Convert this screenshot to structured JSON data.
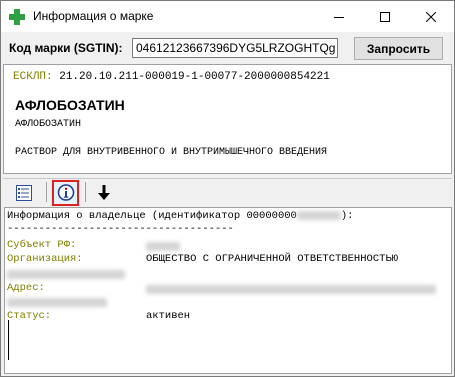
{
  "window": {
    "title": "Информация о марке",
    "controls": {
      "minimize": "minimize",
      "maximize": "maximize",
      "close": "close"
    }
  },
  "sgtin": {
    "label": "Код марки (SGTIN):",
    "value": "04612123667396DYG5LRZOGHTQg",
    "request_label": "Запросить"
  },
  "product": {
    "esklp_label": "ЕСКЛП:",
    "esklp_value": "21.20.10.211-000019-1-00077-2000000854221",
    "name": "АФЛОБОЗАТИН",
    "subname": "АФЛОБОЗАТИН",
    "form": "РАСТВОР ДЛЯ ВНУТРИВЕННОГО И ВНУТРИМЫШЕЧНОГО ВВЕДЕНИЯ"
  },
  "toolbar": {
    "list_icon": "list-icon",
    "info_icon": "info-icon",
    "download_icon": "arrow-down-icon"
  },
  "owner": {
    "header": "Информация о владельце (идентификатор 00000000",
    "header_end": "):",
    "separator": "------------------------------------",
    "subject_label": "Субъект РФ:",
    "org_label": "Организация:",
    "org_value": "ОБЩЕСТВО С ОГРАНИЧЕННОЙ ОТВЕТСТВЕННОСТЬЮ",
    "address_label": "Адрес:",
    "status_label": "Статус:",
    "status_value": "активен"
  },
  "colors": {
    "label_olive": "#808000",
    "active_border": "#e02020",
    "app_icon_green": "#2ea043"
  }
}
